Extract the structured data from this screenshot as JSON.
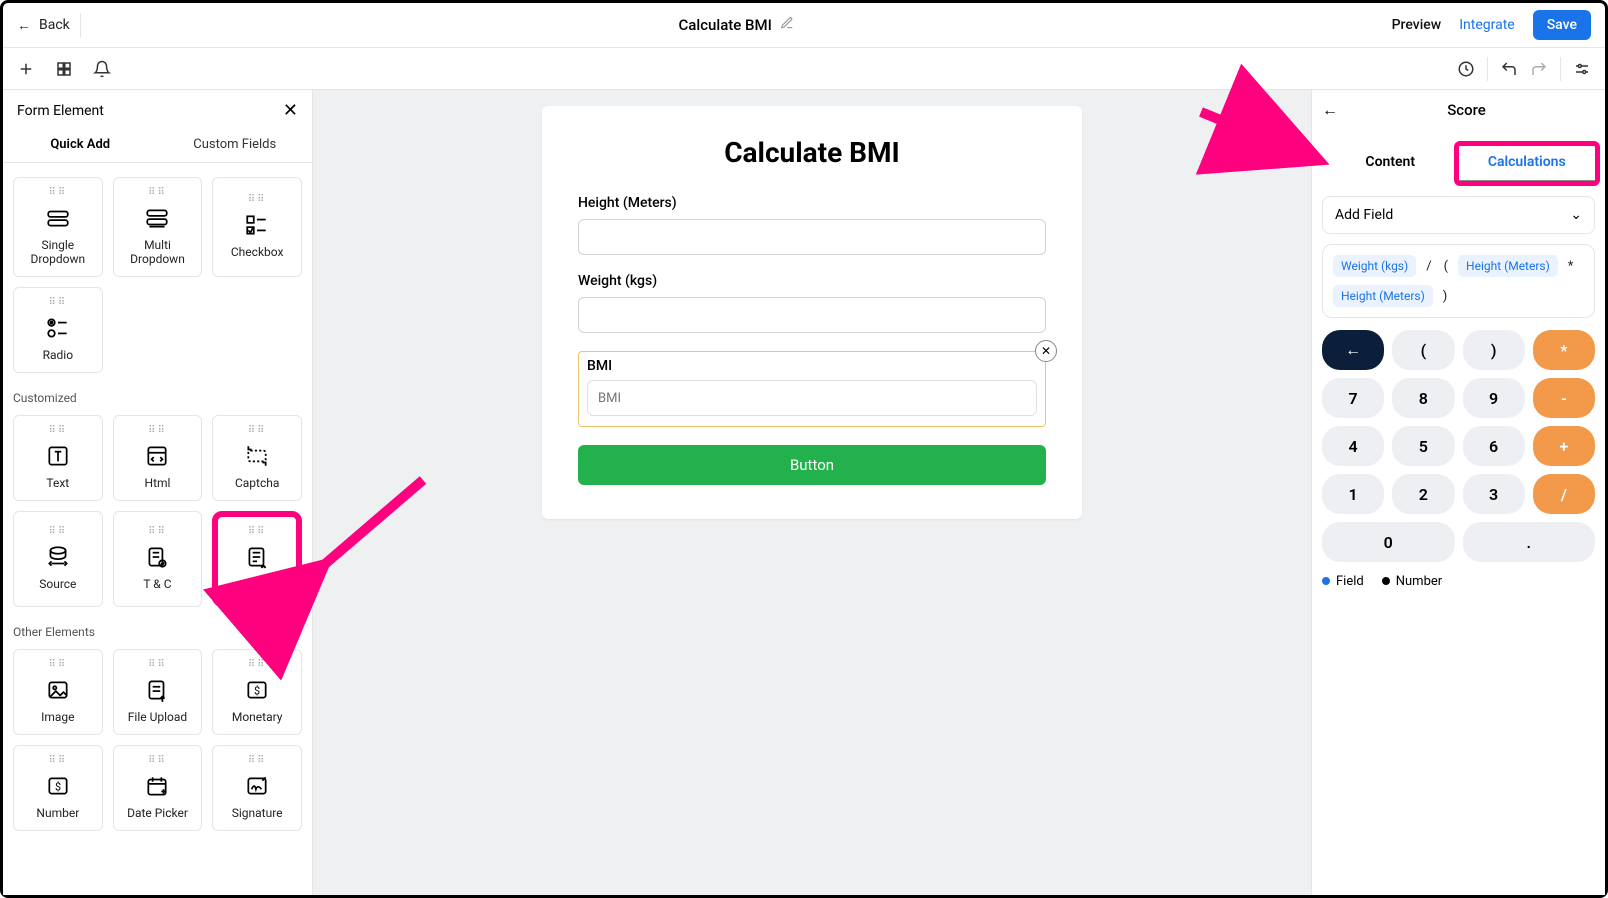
{
  "topbar": {
    "back_label": "Back",
    "title": "Calculate BMI",
    "preview_label": "Preview",
    "integrate_label": "Integrate",
    "save_label": "Save"
  },
  "left_panel": {
    "title": "Form Element",
    "tabs": {
      "quick": "Quick Add",
      "custom": "Custom Fields"
    },
    "row1": [
      {
        "label": "Single Dropdown"
      },
      {
        "label": "Multi Dropdown"
      },
      {
        "label": "Checkbox"
      }
    ],
    "row1b": [
      {
        "label": "Radio"
      }
    ],
    "section_customized": "Customized",
    "row2": [
      {
        "label": "Text"
      },
      {
        "label": "Html"
      },
      {
        "label": "Captcha"
      }
    ],
    "row3": [
      {
        "label": "Source"
      },
      {
        "label": "T & C"
      },
      {
        "label": "Score"
      }
    ],
    "section_other": "Other Elements",
    "row4": [
      {
        "label": "Image"
      },
      {
        "label": "File Upload"
      },
      {
        "label": "Monetary"
      }
    ],
    "row5": [
      {
        "label": "Number"
      },
      {
        "label": "Date Picker"
      },
      {
        "label": "Signature"
      }
    ]
  },
  "form": {
    "title": "Calculate BMI",
    "height_label": "Height (Meters)",
    "weight_label": "Weight (kgs)",
    "bmi_label": "BMI",
    "bmi_placeholder": "BMI",
    "button_label": "Button"
  },
  "right_panel": {
    "title": "Score",
    "tab_content": "Content",
    "tab_calc": "Calculations",
    "add_field": "Add Field",
    "formula_tokens": [
      {
        "type": "field",
        "text": "Weight (kgs)"
      },
      {
        "type": "op",
        "text": "/"
      },
      {
        "type": "op",
        "text": "("
      },
      {
        "type": "field",
        "text": "Height (Meters)"
      },
      {
        "type": "op",
        "text": "*"
      },
      {
        "type": "field",
        "text": "Height (Meters)"
      },
      {
        "type": "op",
        "text": ")"
      }
    ],
    "pad": {
      "back": "←",
      "lp": "(",
      "rp": ")",
      "mul": "*",
      "n7": "7",
      "n8": "8",
      "n9": "9",
      "sub": "-",
      "n4": "4",
      "n5": "5",
      "n6": "6",
      "add": "+",
      "n1": "1",
      "n2": "2",
      "n3": "3",
      "div": "/",
      "n0": "0",
      "dot": "."
    },
    "legend_field": "Field",
    "legend_number": "Number"
  }
}
